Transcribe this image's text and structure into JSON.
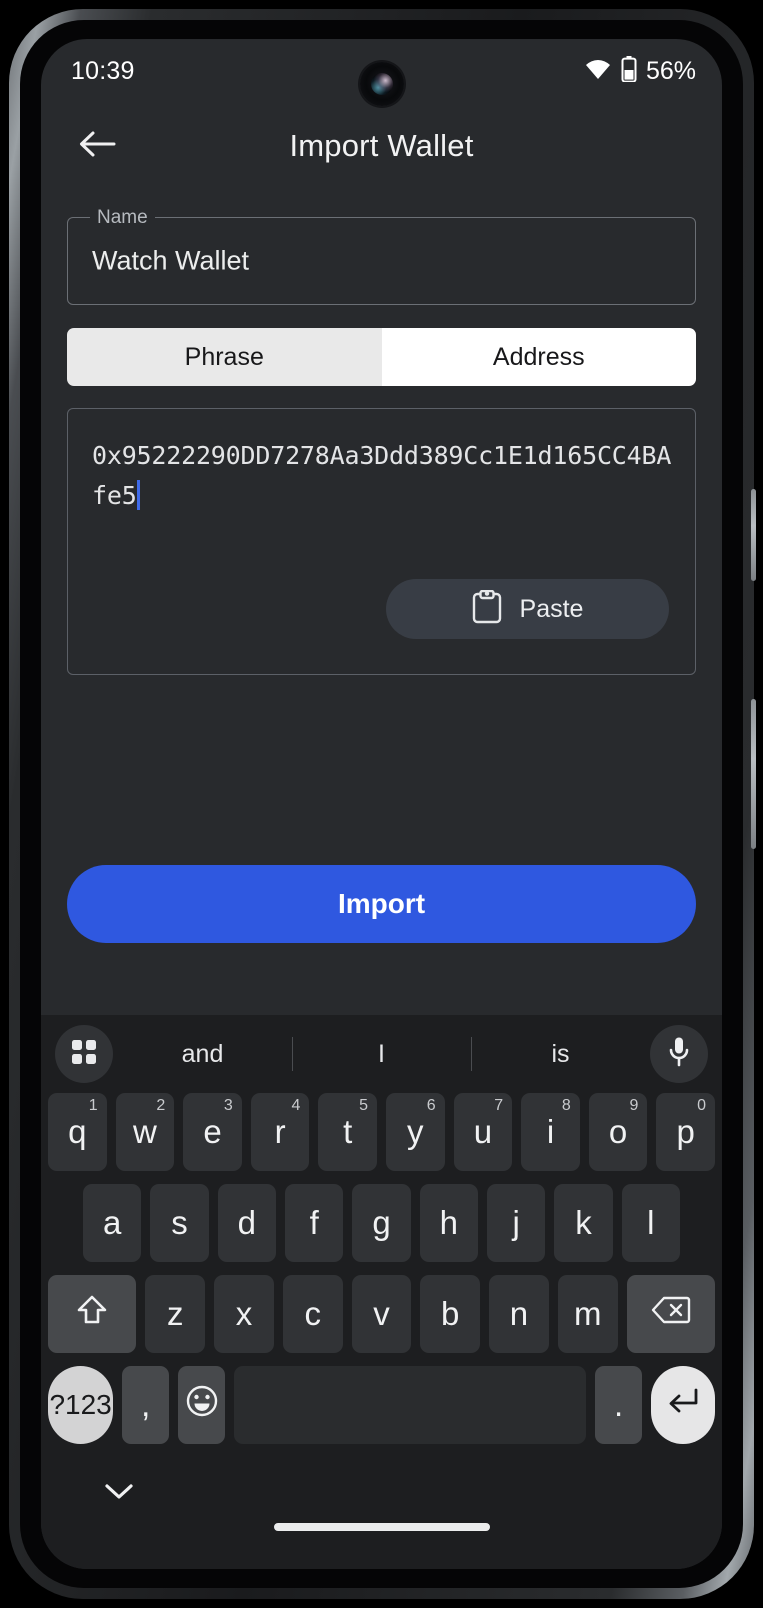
{
  "status_bar": {
    "time": "10:39",
    "battery_percent": "56%",
    "wifi_icon": "wifi-icon",
    "battery_icon": "battery-icon",
    "camera_icon": "front-camera-punch-hole"
  },
  "header": {
    "back_icon": "back-arrow-icon",
    "title": "Import Wallet"
  },
  "form": {
    "name_field": {
      "label": "Name",
      "value": "Watch Wallet"
    },
    "tabs": [
      {
        "label": "Phrase",
        "selected": false
      },
      {
        "label": "Address",
        "selected": true
      }
    ],
    "address_field": {
      "value": "0x95222290DD7278Aa3Ddd389Cc1E1d165CC4BAfe5",
      "caret_visible": true,
      "paste_button": {
        "label": "Paste",
        "icon": "clipboard-icon"
      }
    },
    "submit_button": {
      "label": "Import",
      "color": "#2f58e0"
    }
  },
  "keyboard": {
    "suggestion_bar": {
      "grid_icon": "grid-menu-icon",
      "mic_icon": "microphone-icon",
      "suggestions": [
        "and",
        "I",
        "is"
      ]
    },
    "row1": [
      {
        "key": "q",
        "sup": "1"
      },
      {
        "key": "w",
        "sup": "2"
      },
      {
        "key": "e",
        "sup": "3"
      },
      {
        "key": "r",
        "sup": "4"
      },
      {
        "key": "t",
        "sup": "5"
      },
      {
        "key": "y",
        "sup": "6"
      },
      {
        "key": "u",
        "sup": "7"
      },
      {
        "key": "i",
        "sup": "8"
      },
      {
        "key": "o",
        "sup": "9"
      },
      {
        "key": "p",
        "sup": "0"
      }
    ],
    "row2": [
      "a",
      "s",
      "d",
      "f",
      "g",
      "h",
      "j",
      "k",
      "l"
    ],
    "row3": {
      "shift_icon": "shift-up-arrow-icon",
      "keys": [
        "z",
        "x",
        "c",
        "v",
        "b",
        "n",
        "m"
      ],
      "backspace_icon": "backspace-delete-icon"
    },
    "row4": {
      "symbols_label": "?123",
      "comma_label": ",",
      "emoji_icon": "emoji-smiley-icon",
      "space_label": "",
      "period_label": ".",
      "enter_icon": "enter-return-icon"
    },
    "footer": {
      "hide_keyboard_icon": "chevron-down-icon",
      "home_indicator": "home-gesture-bar"
    }
  }
}
